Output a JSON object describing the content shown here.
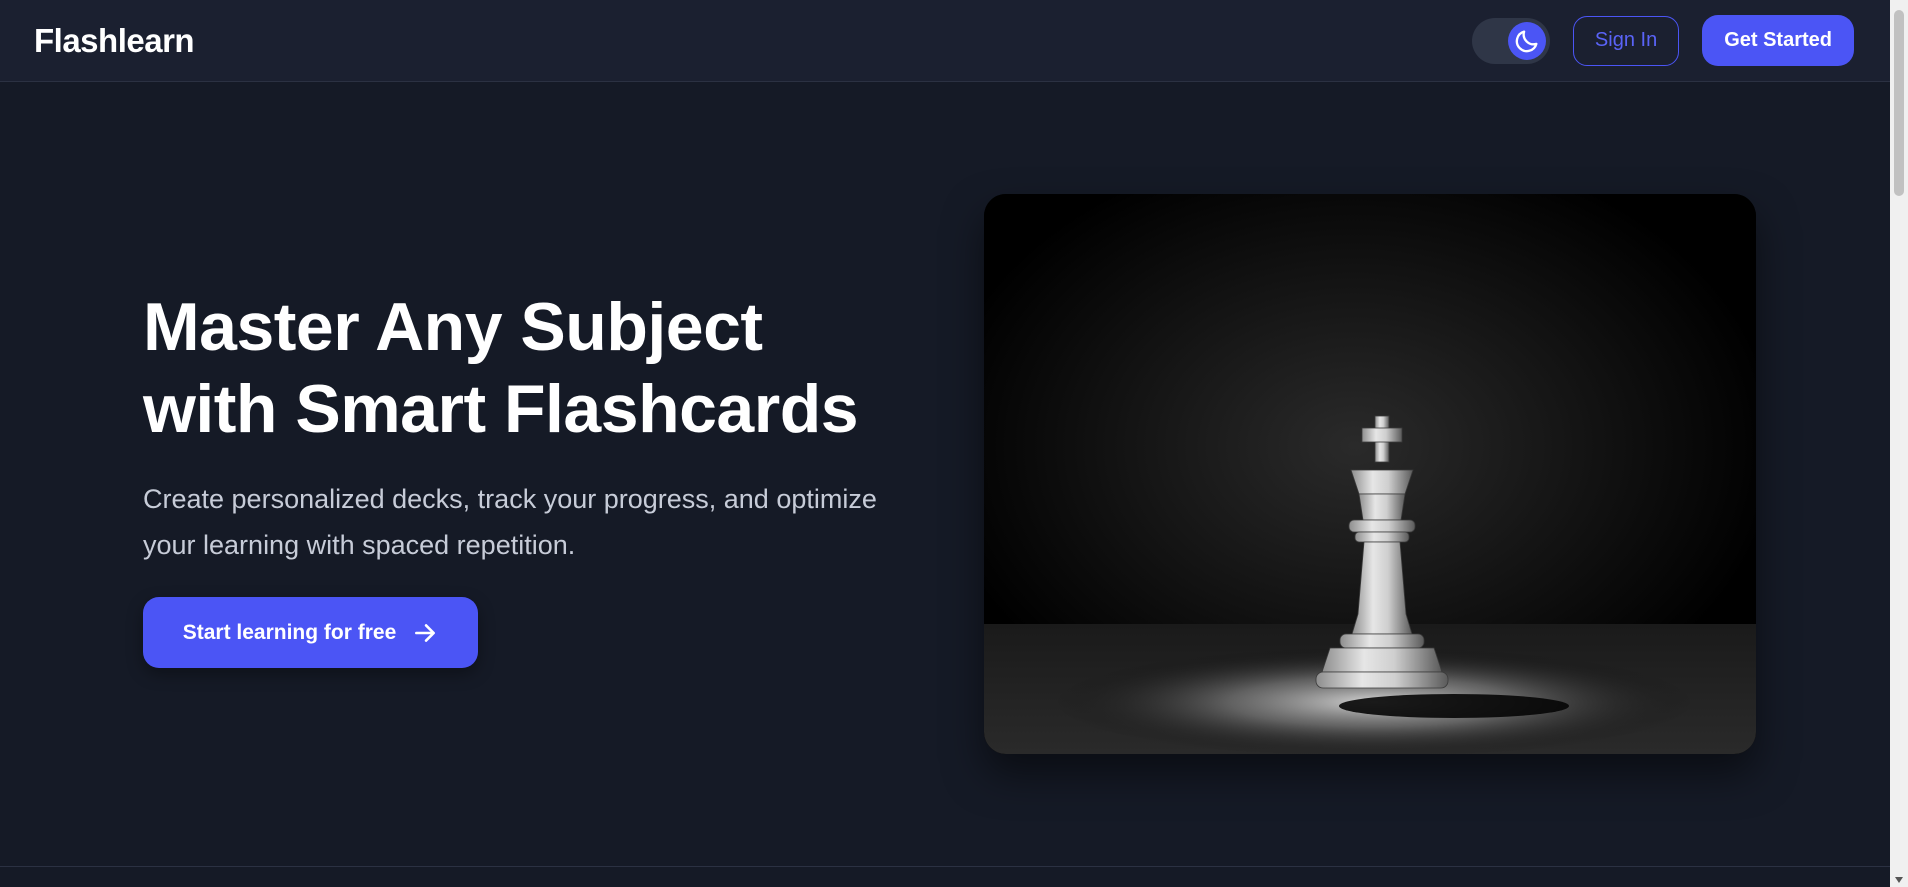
{
  "header": {
    "brand": "Flashlearn",
    "theme_toggle_icon": "moon-icon",
    "signin_label": "Sign In",
    "get_started_label": "Get Started"
  },
  "hero": {
    "title_line1": "Master Any Subject",
    "title_line2": "with Smart Flashcards",
    "subtitle": "Create personalized decks, track your progress, and optimize your learning with spaced repetition.",
    "cta_label": "Start learning for free",
    "cta_icon": "arrow-right-icon",
    "image_subject": "chess-king-image"
  },
  "colors": {
    "accent": "#4b55f5",
    "background": "#151a26",
    "header_bg": "#1b2030",
    "text_primary": "#ffffff",
    "text_secondary": "#c7ccd8"
  }
}
